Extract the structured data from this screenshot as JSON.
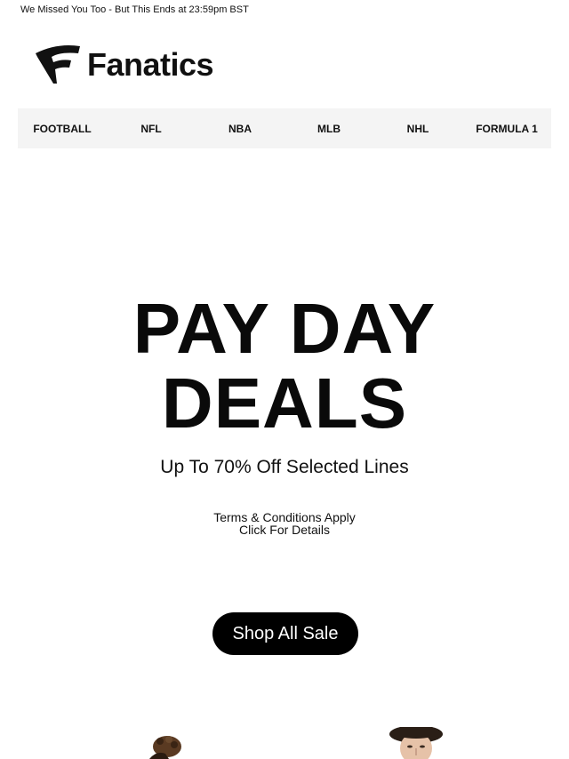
{
  "preheader": {
    "text": "We Missed You Too - But This Ends at 23:59pm BST"
  },
  "brand": {
    "name": "Fanatics",
    "color": "#111111"
  },
  "nav": {
    "items": [
      {
        "label": "FOOTBALL"
      },
      {
        "label": "NFL"
      },
      {
        "label": "NBA"
      },
      {
        "label": "MLB"
      },
      {
        "label": "NHL"
      },
      {
        "label": "FORMULA 1"
      }
    ]
  },
  "hero": {
    "title_line1": "PAY DAY",
    "title_line2": "DEALS",
    "subtitle": "Up To 70% Off Selected Lines",
    "terms_line1": "Terms & Conditions Apply",
    "terms_line2": "Click For Details",
    "cta_label": "Shop All Sale"
  },
  "colors": {
    "cta_bg": "#000000",
    "cta_text": "#ffffff",
    "nav_bg": "#f4f4f4"
  }
}
